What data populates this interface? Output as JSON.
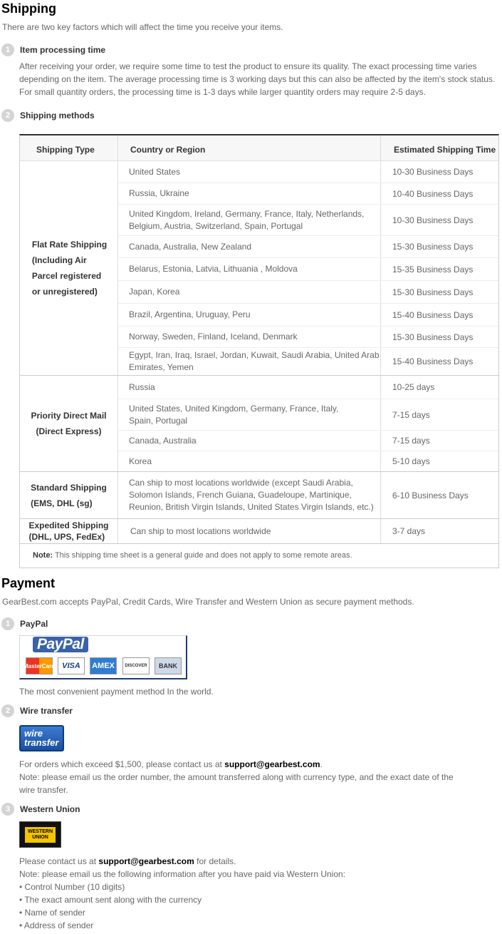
{
  "shipping": {
    "title": "Shipping",
    "intro": "There are two key factors which will affect the time you receive your items.",
    "step1": {
      "num": "1",
      "title": "Item processing time",
      "lines": [
        "After receiving your order, we require some time to test the product to ensure its quality. The exact processing time varies",
        "depending on the item. The average processing time is 3 working days but this can also be affected by the item's stock status.",
        "For small quantity orders, the processing time is 1-3 days while larger quantity orders may require 2-5 days."
      ]
    },
    "step2": {
      "num": "2",
      "title": "Shipping methods"
    },
    "table": {
      "headers": {
        "type": "Shipping Type",
        "country": "Country or Region",
        "time": "Estimated Shipping Time"
      },
      "groups": [
        {
          "type_lines": [
            "Flat Rate Shipping",
            "(Including Air",
            "Parcel  registered",
            "or unregistered)"
          ],
          "rows": [
            {
              "country": "United States",
              "time": "10-30 Business Days"
            },
            {
              "country": "Russia, Ukraine",
              "time": "10-40 Business Days"
            },
            {
              "country": "United Kingdom, Ireland, Germany, France, Italy, Netherlands, Belgium, Austria, Switzerland, Spain, Portugal",
              "time": "10-30 Business Days"
            },
            {
              "country": "Canada, Australia, New Zealand",
              "time": "15-30 Business Days"
            },
            {
              "country": "Belarus, Estonia, Latvia, Lithuania , Moldova",
              "time": "15-35 Business Days"
            },
            {
              "country": "Japan, Korea",
              "time": "15-30 Business Days"
            },
            {
              "country": "Brazil, Argentina, Uruguay, Peru",
              "time": "15-40 Business Days"
            },
            {
              "country": "Norway, Sweden, Finland, Iceland, Denmark",
              "time": "15-30 Business Days"
            },
            {
              "country": "Egypt, Iran, Iraq, Israel, Jordan, Kuwait, Saudi Arabia, United Arab Emirates, Yemen",
              "time": "15-40 Business Days"
            }
          ]
        },
        {
          "type_lines": [
            "Priority Direct Mail",
            "(Direct Express)"
          ],
          "rows": [
            {
              "country": "Russia",
              "time": "10-25 days"
            },
            {
              "country": "United States, United Kingdom, Germany, France, Italy, Spain, Portugal",
              "time": "7-15 days"
            },
            {
              "country": "Canada, Australia",
              "time": "7-15 days"
            },
            {
              "country": "Korea",
              "time": "5-10 days"
            }
          ]
        },
        {
          "type_lines": [
            "Standard Shipping",
            "(EMS, DHL (sg)"
          ],
          "rows": [
            {
              "country": "Can ship to most locations worldwide (except Saudi Arabia, Solomon Islands, French Guiana, Guadeloupe, Martinique, Reunion, British Virgin Islands, United States Virgin Islands, etc.)",
              "time": "6-10 Business Days"
            }
          ]
        },
        {
          "type_lines": [
            "Expedited Shipping",
            "(DHL, UPS, FedEx)"
          ],
          "rows": [
            {
              "country": "Can ship to most locations worldwide",
              "time": "3-7 days"
            }
          ]
        }
      ],
      "note_label": "Note:",
      "note_text": " This shipping time sheet is a general guide and does not apply to some remote areas."
    }
  },
  "payment": {
    "title": "Payment",
    "intro": "GearBest.com accepts PayPal, Credit Cards, Wire Transfer and Western Union as secure payment methods.",
    "paypal": {
      "num": "1",
      "title": "PayPal",
      "logo_text": "PayPal",
      "cards": [
        "MasterCard",
        "VISA",
        "AMEX",
        "DISCOVER",
        "BANK"
      ],
      "desc": "The most convenient payment method In the world."
    },
    "wire": {
      "num": "2",
      "title": "Wire transfer",
      "logo_line1": "wire",
      "logo_line2": "transfer",
      "line1_pre": "For orders which exceed $1,500, please contact us at ",
      "email": "support@gearbest.com",
      "line1_post": ".",
      "line2": "Note: please email us the order number, the amount transferred along with currency type, and the exact date of the",
      "line3": "wire transfer."
    },
    "western_union": {
      "num": "3",
      "title": "Western Union",
      "logo_line1": "WESTERN",
      "logo_line2": "UNION",
      "line1_pre": "Please contact us at ",
      "email": "support@gearbest.com",
      "line1_post": " for details.",
      "line2": "Note: please email us the following information after you have paid via Western Union:",
      "bullets": [
        "• Control Number (10 digits)",
        "• The exact amount sent along with the currency",
        "• Name of sender",
        "• Address of sender"
      ]
    }
  },
  "colors": {
    "badge": "#d4d4d4",
    "text": "#666666",
    "heading": "#000000",
    "paypal_blue": "#1e3c7a",
    "wu_yellow": "#f5c400"
  }
}
